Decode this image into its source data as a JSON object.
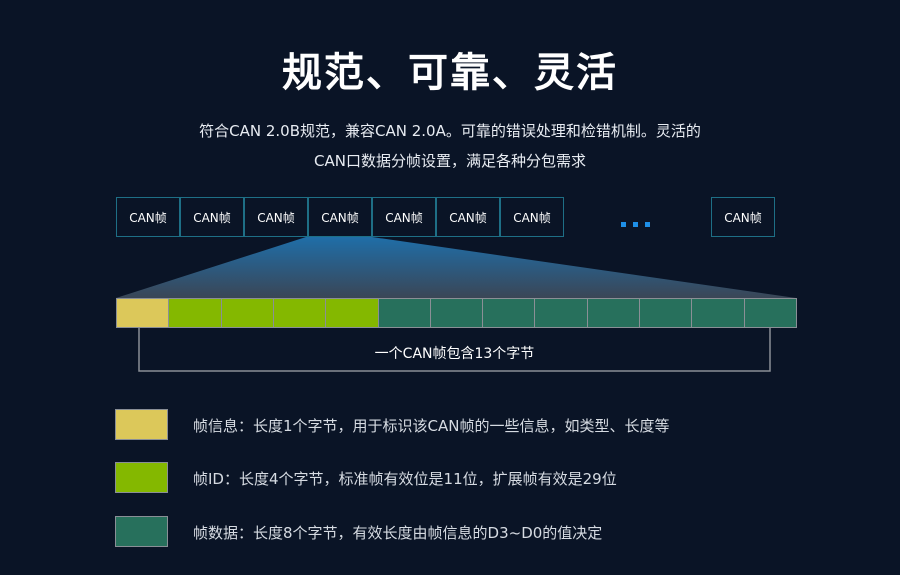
{
  "title": "规范、可靠、灵活",
  "subtitle_lines": [
    "符合CAN 2.0B规范，兼容CAN 2.0A。可靠的错误处理和检错机制。灵活的",
    "CAN口数据分帧设置，满足各种分包需求"
  ],
  "frames": [
    "CAN帧",
    "CAN帧",
    "CAN帧",
    "CAN帧",
    "CAN帧",
    "CAN帧",
    "CAN帧"
  ],
  "last_frame": "CAN帧",
  "colors": {
    "info": "#dcc85a",
    "id": "#84b800",
    "data": "#27705c"
  },
  "bytes": [
    "info",
    "id",
    "id",
    "id",
    "id",
    "data",
    "data",
    "data",
    "data",
    "data",
    "data",
    "data",
    "data"
  ],
  "bracket_label": "一个CAN帧包含13个字节",
  "legend": [
    {
      "type": "info",
      "text": "帧信息：长度1个字节，用于标识该CAN帧的一些信息，如类型、长度等"
    },
    {
      "type": "id",
      "text": "帧ID：长度4个字节，标准帧有效位是11位，扩展帧有效是29位"
    },
    {
      "type": "data",
      "text": "帧数据：长度8个字节，有效长度由帧信息的D3~D0的值决定"
    }
  ]
}
